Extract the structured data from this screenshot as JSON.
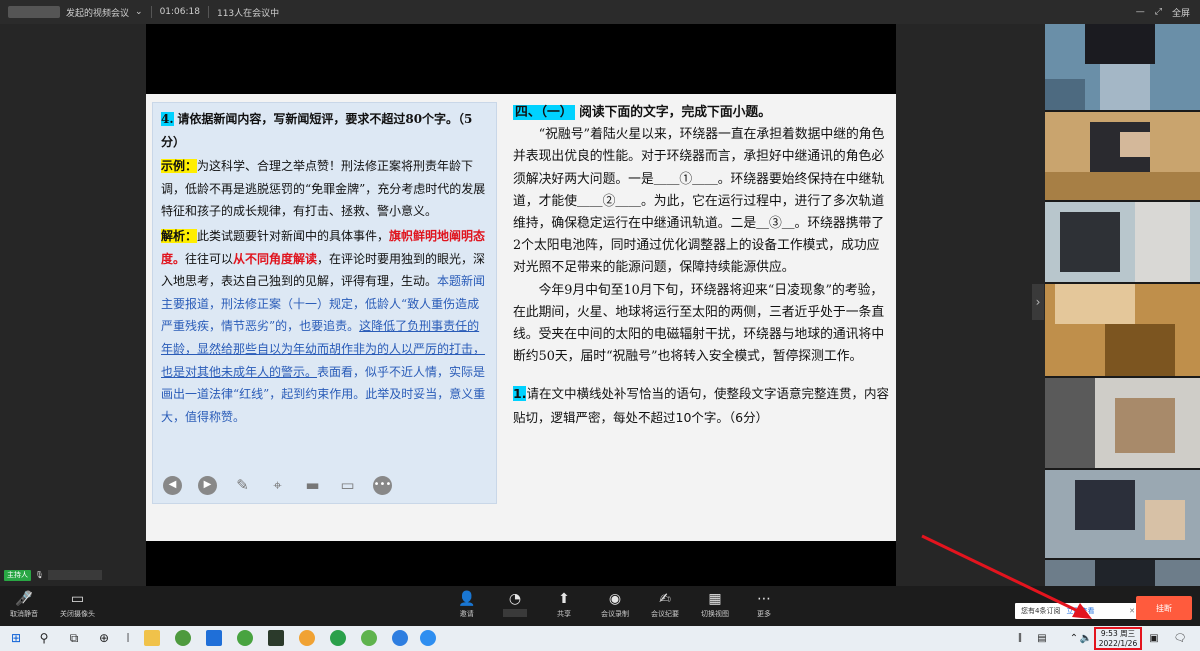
{
  "titlebar": {
    "meeting_title": "发起的视频会议",
    "duration": "01:06:18",
    "participants": "113人在会议中",
    "fullscreen_label": "全屏"
  },
  "slide": {
    "left": {
      "q_num": "4.",
      "q_text": "请依据新闻内容，写新闻短评，要求不超过80个字。（5分）",
      "example_label": "示例：",
      "example_text": "为这科学、合理之举点赞！刑法修正案将刑责年龄下调，低龄不再是逃脱惩罚的“免罪金牌”，充分考虑时代的发展特征和孩子的成长规律，有打击、拯救、警小意义。",
      "analysis_label": "解析：",
      "analysis_a": "此类试题要针对新闻中的具体事件，",
      "analysis_red1": "旗帜鲜明地阐明态度。",
      "analysis_b": "往往可以",
      "analysis_red2": "从不同角度解读",
      "analysis_c": "，在评论时要用独到的眼光，深入地思考，表达自己独到的见解，评得有理，生动。",
      "analysis_blue1": "本题新闻主要报道，刑法修正案（十一）规定，低龄人“致人重伤造成严重残疾，情节恶劣”的，也要追责。",
      "analysis_blue_ul": "这降低了负刑事责任的年龄，显然给那些自以为年幼而胡作非为的人以严厉的打击，也是对其他未成年人的警示。",
      "analysis_blue2": "表面看，似乎不近人情，实际是画出一道法律“红线”，起到约束作用。此举及时妥当，意义重大，值得称赞。"
    },
    "right": {
      "heading_label": "四、（一）",
      "heading_text": "阅读下面的文字，完成下面小题。",
      "p1": "“祝融号”着陆火星以来，环绕器一直在承担着数据中继的角色并表现出优良的性能。对于环绕器而言，承担好中继通讯的角色必须解决好两大问题。一是＿＿①＿＿。环绕器要始终保持在中继轨道，才能使＿＿②＿＿。为此，它在运行过程中，进行了多次轨道维持，确保稳定运行在中继通讯轨道。二是＿③＿。环绕器携带了2个太阳电池阵，同时通过优化调整器上的设备工作模式，成功应对光照不足带来的能源问题，保障持续能源供应。",
      "p2": "今年9月中旬至10月下旬，环绕器将迎来“日凌现象”的考验，在此期间，火星、地球将运行至太阳的两侧，三者近乎处于一条直线。受夹在中间的太阳的电磁辐射干扰，环绕器与地球的通讯将中断约50天，届时“祝融号”也将转入安全模式，暂停探测工作。",
      "q_num": "1.",
      "q_text": "请在文中横线处补写恰当的语句，使整段文字语意完整连贯，内容贴切，逻辑严密，每处不超过10个字。（6分）"
    }
  },
  "host": {
    "badge": "主持人"
  },
  "toolbar": {
    "mute": "取消静音",
    "camera": "关闭摄像头",
    "invite": "邀请",
    "share": "共享",
    "record": "会议录制",
    "minutes": "会议纪要",
    "layout": "切换视图",
    "more": "更多",
    "notice": "您有4条订阅",
    "notice_link": "立即查看",
    "leave": "挂断"
  },
  "taskbar": {
    "time": "9:53 周三",
    "date": "2022/1/26"
  },
  "icons": {
    "mic": "mic-off-icon",
    "camera": "camera-icon",
    "invite": "add-user-icon",
    "share": "share-screen-icon",
    "record": "record-icon",
    "minutes": "minutes-icon",
    "layout": "grid-view-icon",
    "more": "more-icon"
  },
  "colors": {
    "leave_button": "#ff5b3d",
    "host_badge": "#29a744",
    "highlight_blue": "#00d2ff",
    "highlight_yellow": "#ffee00",
    "emphasis_red": "#e0141e",
    "annotation_red": "#e3141e"
  }
}
